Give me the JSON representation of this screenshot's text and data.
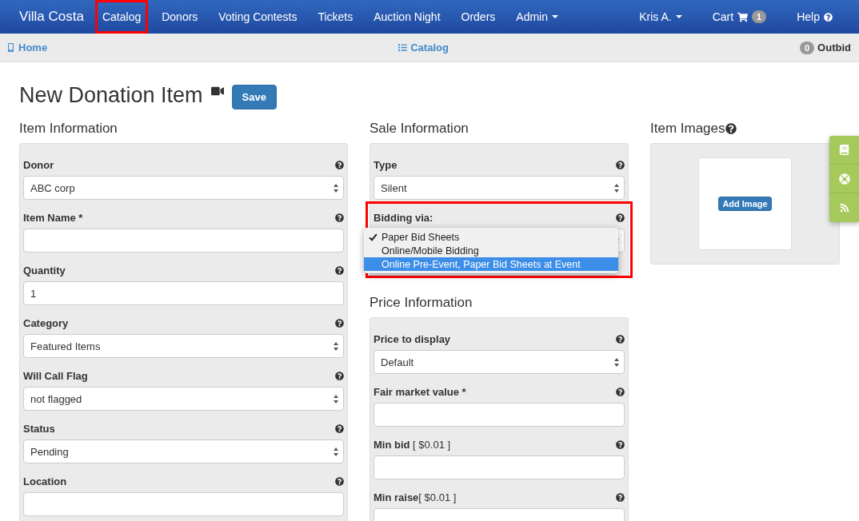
{
  "brand": "Villa Costa",
  "nav_left": [
    {
      "label": "Catalog",
      "highlighted": true,
      "dropdown": false
    },
    {
      "label": "Donors",
      "highlighted": false,
      "dropdown": false
    },
    {
      "label": "Voting Contests",
      "highlighted": false,
      "dropdown": false
    },
    {
      "label": "Tickets",
      "highlighted": false,
      "dropdown": false
    },
    {
      "label": "Auction Night",
      "highlighted": false,
      "dropdown": false
    },
    {
      "label": "Orders",
      "highlighted": false,
      "dropdown": false
    },
    {
      "label": "Admin",
      "highlighted": false,
      "dropdown": true
    }
  ],
  "nav_right": [
    {
      "label": "Kris A.",
      "kind": "dropdown"
    },
    {
      "label": "Cart",
      "kind": "cart",
      "badge": "1"
    },
    {
      "label": "Help",
      "kind": "help"
    }
  ],
  "subbar": {
    "home": "Home",
    "catalog": "Catalog",
    "outbid_count": "0",
    "outbid": "Outbid"
  },
  "page_title": "New Donation Item",
  "save": "Save",
  "item_information": {
    "title": "Item Information",
    "fields": [
      {
        "label": "Donor",
        "kind": "select",
        "value": "ABC corp"
      },
      {
        "label": "Item Name *",
        "kind": "text"
      },
      {
        "label": "Quantity",
        "kind": "text",
        "value": "1"
      },
      {
        "label": "Category",
        "kind": "select",
        "value": "Featured Items"
      },
      {
        "label": "Will Call Flag",
        "kind": "select",
        "value": "not flagged"
      },
      {
        "label": "Status",
        "kind": "select",
        "value": "Pending"
      },
      {
        "label": "Location",
        "kind": "text"
      }
    ]
  },
  "sale_information": {
    "title": "Sale Information",
    "fields": [
      {
        "label": "Type",
        "kind": "select",
        "value": "Silent"
      },
      {
        "label": "Bidding via:",
        "kind": "select",
        "highlighted": true,
        "options": [
          {
            "label": "Paper Bid Sheets",
            "selected": true,
            "highlighted": false
          },
          {
            "label": "Online/Mobile Bidding",
            "selected": false,
            "highlighted": false
          },
          {
            "label": "Online Pre-Event, Paper Bid Sheets at Event",
            "selected": false,
            "highlighted": true
          }
        ]
      }
    ]
  },
  "price_information": {
    "title": "Price Information",
    "fields": [
      {
        "label": "Price to display",
        "kind": "select",
        "value": "Default"
      },
      {
        "label": "Fair market value *",
        "kind": "text"
      },
      {
        "label": "Min bid",
        "note": " [ $0.01 ]",
        "kind": "text"
      },
      {
        "label": "Min raise",
        "note": "[ $0.01 ]",
        "kind": "text"
      }
    ]
  },
  "item_images": {
    "title": "Item Images",
    "button": "Add Image"
  }
}
